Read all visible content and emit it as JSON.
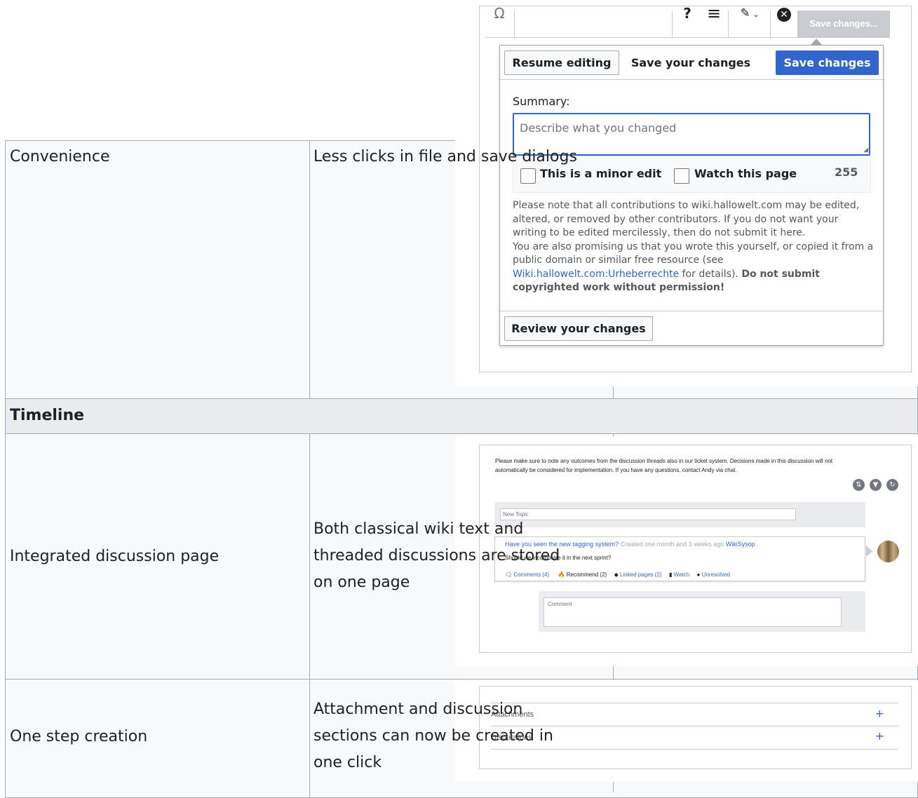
{
  "table": {
    "rows": [
      {
        "feature": "Convenience",
        "description": "Less clicks in file and save dialogs"
      },
      {
        "section": "Timeline"
      },
      {
        "feature": "Integrated discussion page",
        "description_lines": [
          "Both classical wiki text and",
          "threaded discussions are stored",
          "on one page"
        ]
      },
      {
        "feature": "One step creation",
        "description_lines": [
          "Attachment and discussion",
          "sections can now be created in",
          "one click"
        ]
      }
    ]
  },
  "save_screenshot": {
    "toolbar": {
      "special_char_icon": "Ω",
      "help_icon": "?",
      "menu_icon": "≡",
      "edit_mode_icon": "pencil-icon",
      "close_icon": "close-circle-icon",
      "save_label": "Save changes..."
    },
    "dialog": {
      "resume_label": "Resume editing",
      "title": "Save your changes",
      "save_label": "Save changes",
      "summary_label": "Summary:",
      "summary_placeholder": "Describe what you changed",
      "minor_edit_label": "This is a minor edit",
      "watch_label": "Watch this page",
      "char_count": "255",
      "notice_1": "Please note that all contributions to wiki.hallowelt.com may be edited,",
      "notice_2": "altered, or removed by other contributors. If you do not want your",
      "notice_3": "writing to be edited mercilessly, then do not submit it here.",
      "notice_4": "You are also promising us that you wrote this yourself, or copied it from a",
      "notice_5": "public domain or similar free resource (see",
      "notice_link": "Wiki.hallowelt.com:Urheberrechte",
      "notice_6": " for details). ",
      "notice_bold_1": "Do not submit",
      "notice_bold_2": "copyrighted work without permission!",
      "review_label": "Review your changes"
    }
  },
  "discussion_screenshot": {
    "intro_1": "Please make sure to note any outcomes from the discussion threads also in our ticket system. Decisions made in this discussion will not",
    "intro_2": "automatically be considered for implementation. If you have any questions, contact Andy via chat.",
    "new_topic_placeholder": "New Topic",
    "topic_title": "Have you seen the new tagging system?",
    "topic_meta": "Created one month and 3 weeks ago",
    "topic_author": "WikiSysop",
    "topic_body": "Should we incorporate it in the next sprint?",
    "actions": [
      "Comments (4)",
      "Recommend (2)",
      "Linked pages (2)",
      "Watch",
      "Unresolved"
    ],
    "comment_placeholder": "Comment"
  },
  "onestep_screenshot": {
    "sections": [
      "Attachments",
      "Discussions"
    ],
    "add_symbol": "+"
  }
}
